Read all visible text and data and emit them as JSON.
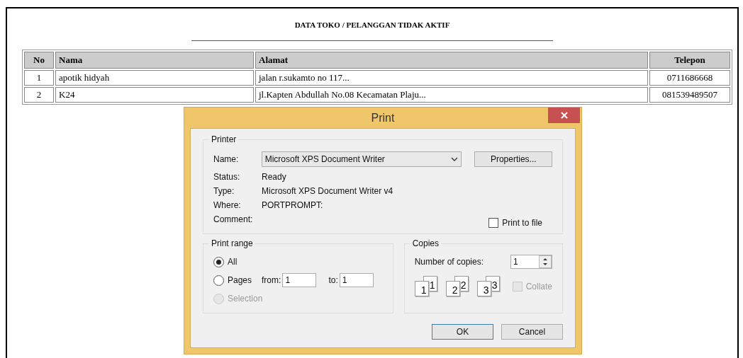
{
  "report": {
    "title": "DATA TOKO / PELANGGAN TIDAK AKTIF",
    "columns": [
      "No",
      "Nama",
      "Alamat",
      "Telepon"
    ],
    "rows": [
      [
        "1",
        "apotik hidyah",
        "jalan r.sukamto no 117...",
        "0711686668"
      ],
      [
        "2",
        "K24",
        "jl.Kapten Abdullah No.08 Kecamatan Plaju...",
        "081539489507"
      ]
    ]
  },
  "dialog": {
    "title": "Print",
    "printer": {
      "legend": "Printer",
      "name_label": "Name:",
      "name_value": "Microsoft XPS Document Writer",
      "properties_button": "Properties...",
      "info": [
        {
          "label": "Status:",
          "value": "Ready"
        },
        {
          "label": "Type:",
          "value": "Microsoft XPS Document Writer v4"
        },
        {
          "label": "Where:",
          "value": "PORTPROMPT:"
        },
        {
          "label": "Comment:"
        }
      ],
      "print_to_file": {
        "label": "Print to file",
        "checked": false
      }
    },
    "print_range": {
      "legend": "Print range",
      "options": [
        {
          "label": "All",
          "selected": true,
          "disabled": false
        },
        {
          "label": "Pages",
          "selected": false,
          "disabled": false
        },
        {
          "label": "Selection",
          "selected": false,
          "disabled": true
        }
      ],
      "from_label": "from:",
      "from_value": "1",
      "to_label": "to:",
      "to_value": "1"
    },
    "copies": {
      "legend": "Copies",
      "number_label": "Number of copies:",
      "number_value": "1",
      "sets": [
        {
          "back": "1",
          "front": "1"
        },
        {
          "back": "2",
          "front": "2"
        },
        {
          "back": "3",
          "front": "3"
        }
      ],
      "collate": {
        "label": "Collate",
        "checked": false,
        "disabled": true
      }
    },
    "buttons": [
      {
        "label": "OK",
        "default": true
      },
      {
        "label": "Cancel",
        "default": false
      }
    ]
  }
}
